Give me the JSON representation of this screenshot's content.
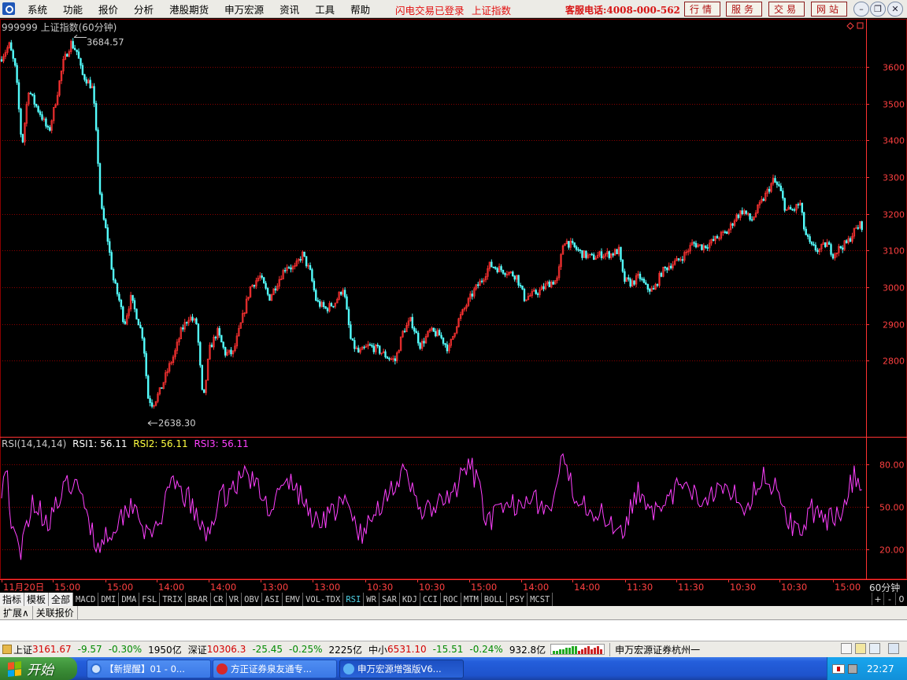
{
  "menu": {
    "items": [
      "系统",
      "功能",
      "报价",
      "分析",
      "港股期货",
      "申万宏源",
      "资讯",
      "工具",
      "帮助"
    ],
    "login_status": "闪电交易已登录",
    "market_name": "上证指数",
    "hotline": "客服电话:4008-000-562",
    "quick_buttons": [
      "行情",
      "服务",
      "交易",
      "网站"
    ]
  },
  "chart": {
    "title": "999999 上证指数(60分钟)",
    "high_label": "3684.57",
    "low_label": "2638.30",
    "period": "60分钟",
    "price_axis": [
      "3600",
      "3500",
      "3400",
      "3300",
      "3200",
      "3100",
      "3000",
      "2900",
      "2800"
    ],
    "rsi_axis": [
      "80.00",
      "50.00",
      "20.00"
    ],
    "time_axis": [
      "11月20日",
      "15:00",
      "15:00",
      "14:00",
      "14:00",
      "13:00",
      "13:00",
      "10:30",
      "10:30",
      "15:00",
      "14:00",
      "14:00",
      "11:30",
      "11:30",
      "10:30",
      "10:30",
      "15:00"
    ],
    "colors": {
      "up": "#ff3232",
      "down": "#54ffff",
      "grid": "#8a0000",
      "axis": "#ff3232",
      "rsi": "#ff40ff"
    }
  },
  "rsi": {
    "label": "RSI(14,14,14)",
    "rsi1": "RSI1: 56.11",
    "rsi2": "RSI2: 56.11",
    "rsi3": "RSI3: 56.11"
  },
  "indicator_tabs": {
    "cn": [
      "指标",
      "模板",
      "全部"
    ],
    "codes": [
      "MACD",
      "DMI",
      "DMA",
      "FSL",
      "TRIX",
      "BRAR",
      "CR",
      "VR",
      "OBV",
      "ASI",
      "EMV",
      "VOL-TDX",
      "RSI",
      "WR",
      "SAR",
      "KDJ",
      "CCI",
      "ROC",
      "MTM",
      "BOLL",
      "PSY",
      "MCST"
    ],
    "active": "RSI",
    "zoom": [
      "+",
      "-",
      "0"
    ]
  },
  "sub_tabs": [
    "扩展∧",
    "关联报价"
  ],
  "status": {
    "sh": {
      "name": "上证",
      "price": "3161.67",
      "change": "-9.57",
      "pct": "-0.30%",
      "amount": "1950亿"
    },
    "sz": {
      "name": "深证",
      "price": "10306.3",
      "change": "-25.45",
      "pct": "-0.25%",
      "amount": "2225亿"
    },
    "sme": {
      "name": "中小",
      "price": "6531.10",
      "change": "-15.51",
      "pct": "-0.24%",
      "amount": "932.8亿"
    },
    "broker": "申万宏源证券杭州一"
  },
  "taskbar": {
    "start": "开始",
    "tasks": [
      "【新提醒】01 - 0...",
      "方正证券泉友通专...",
      "申万宏源增强版V6..."
    ],
    "clock": "22:27"
  }
}
